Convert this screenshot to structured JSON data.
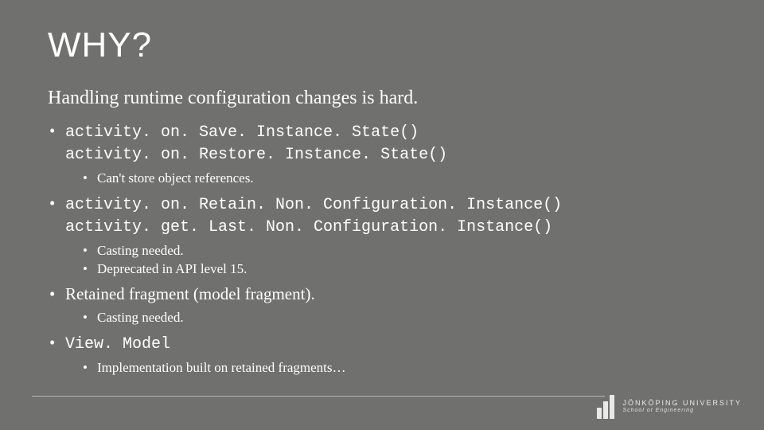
{
  "title": "WHY?",
  "subtitle": "Handling runtime configuration changes is hard.",
  "bullets": [
    {
      "lines": [
        "activity. on. Save. Instance. State()",
        "activity. on. Restore. Instance. State()"
      ],
      "mono": true,
      "sub": [
        "Can't store object references."
      ]
    },
    {
      "lines": [
        "activity. on. Retain. Non. Configuration. Instance()",
        "activity. get. Last. Non. Configuration. Instance()"
      ],
      "mono": true,
      "sub": [
        "Casting needed.",
        "Deprecated in API level 15."
      ]
    },
    {
      "lines": [
        "Retained fragment (model fragment)."
      ],
      "mono": false,
      "sub": [
        "Casting needed."
      ]
    },
    {
      "lines": [
        "View. Model"
      ],
      "mono": true,
      "sub": [
        "Implementation built on retained fragments…"
      ]
    }
  ],
  "footer": {
    "org": "JÖNKÖPING UNIVERSITY",
    "dept": "School of Engineering"
  }
}
